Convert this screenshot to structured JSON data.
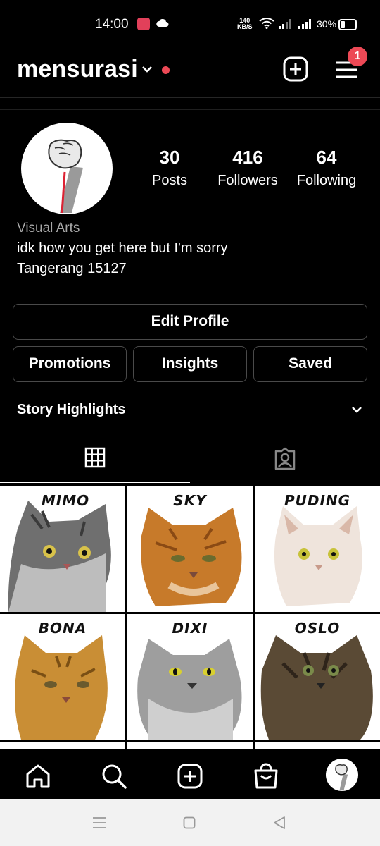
{
  "status_bar": {
    "time": "14:00",
    "net_speed_value": "140",
    "net_speed_unit": "KB/S",
    "battery": "30%"
  },
  "header": {
    "username": "mensurasi",
    "menu_badge": "1"
  },
  "profile": {
    "posts_count": "30",
    "posts_label": "Posts",
    "followers_count": "416",
    "followers_label": "Followers",
    "following_count": "64",
    "following_label": "Following",
    "category": "Visual Arts",
    "bio": "idk how you get here but I'm sorry",
    "location": "Tangerang 15127"
  },
  "buttons": {
    "edit_profile": "Edit Profile",
    "promotions": "Promotions",
    "insights": "Insights",
    "saved": "Saved"
  },
  "story_highlights": "Story Highlights",
  "grid_posts": [
    {
      "name": "MIMO"
    },
    {
      "name": "SKY"
    },
    {
      "name": "PUDING"
    },
    {
      "name": "BONA"
    },
    {
      "name": "DIXI"
    },
    {
      "name": "OSLO"
    }
  ],
  "colors": {
    "accent_red": "#ed4956",
    "background": "#000000"
  }
}
